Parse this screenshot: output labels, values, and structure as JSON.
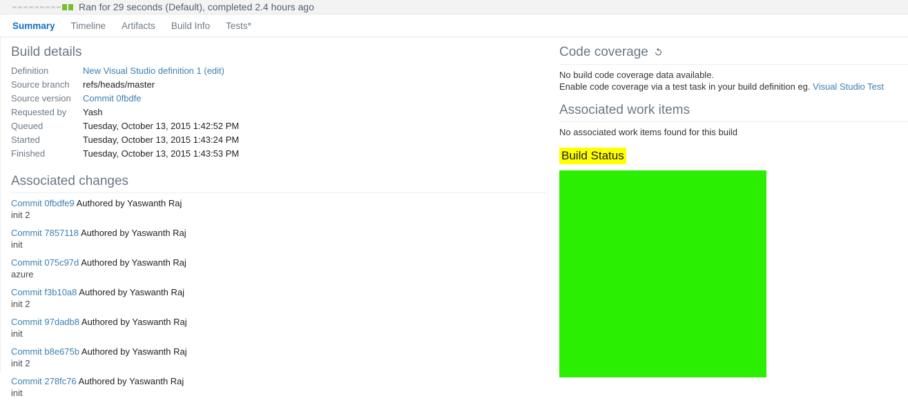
{
  "status_bar": {
    "text": "Ran for 29 seconds (Default), completed 2.4 hours ago",
    "progress_icon": "progress-dashes-complete"
  },
  "tabs": [
    {
      "label": "Summary",
      "active": true
    },
    {
      "label": "Timeline",
      "active": false
    },
    {
      "label": "Artifacts",
      "active": false
    },
    {
      "label": "Build Info",
      "active": false
    },
    {
      "label": "Tests*",
      "active": false
    }
  ],
  "build_details": {
    "heading": "Build details",
    "rows": [
      {
        "label": "Definition",
        "value": "New Visual Studio definition 1 (edit)",
        "link": true
      },
      {
        "label": "Source branch",
        "value": "refs/heads/master",
        "link": false
      },
      {
        "label": "Source version",
        "value": "Commit 0fbdfe",
        "link": true
      },
      {
        "label": "Requested by",
        "value": "Yash",
        "link": false
      },
      {
        "label": "Queued",
        "value": "Tuesday, October 13, 2015 1:42:52 PM",
        "link": false
      },
      {
        "label": "Started",
        "value": "Tuesday, October 13, 2015 1:43:24 PM",
        "link": false
      },
      {
        "label": "Finished",
        "value": "Tuesday, October 13, 2015 1:43:53 PM",
        "link": false
      }
    ]
  },
  "associated_changes": {
    "heading": "Associated changes",
    "items": [
      {
        "commit": "Commit 0fbdfe9",
        "author": "Authored by Yaswanth Raj",
        "message": "init 2"
      },
      {
        "commit": "Commit 7857118",
        "author": "Authored by Yaswanth Raj",
        "message": "init"
      },
      {
        "commit": "Commit 075c97d",
        "author": "Authored by Yaswanth Raj",
        "message": "azure"
      },
      {
        "commit": "Commit f3b10a8",
        "author": "Authored by Yaswanth Raj",
        "message": "init 2"
      },
      {
        "commit": "Commit 97dadb8",
        "author": "Authored by Yaswanth Raj",
        "message": "init"
      },
      {
        "commit": "Commit b8e675b",
        "author": "Authored by Yaswanth Raj",
        "message": "init 2"
      },
      {
        "commit": "Commit 278fc76",
        "author": "Authored by Yaswanth Raj",
        "message": "init"
      }
    ]
  },
  "code_coverage": {
    "heading": "Code coverage",
    "refresh_icon": "refresh-icon",
    "line1": "No build code coverage data available.",
    "line2_prefix": "Enable code coverage via a test task in your build definition eg.",
    "line2_link": "Visual Studio Test"
  },
  "associated_work_items": {
    "heading": "Associated work items",
    "empty_text": "No associated work items found for this build"
  },
  "build_status": {
    "heading": "Build Status",
    "highlight_color": "#ffff00",
    "block_color": "#2bef00"
  }
}
